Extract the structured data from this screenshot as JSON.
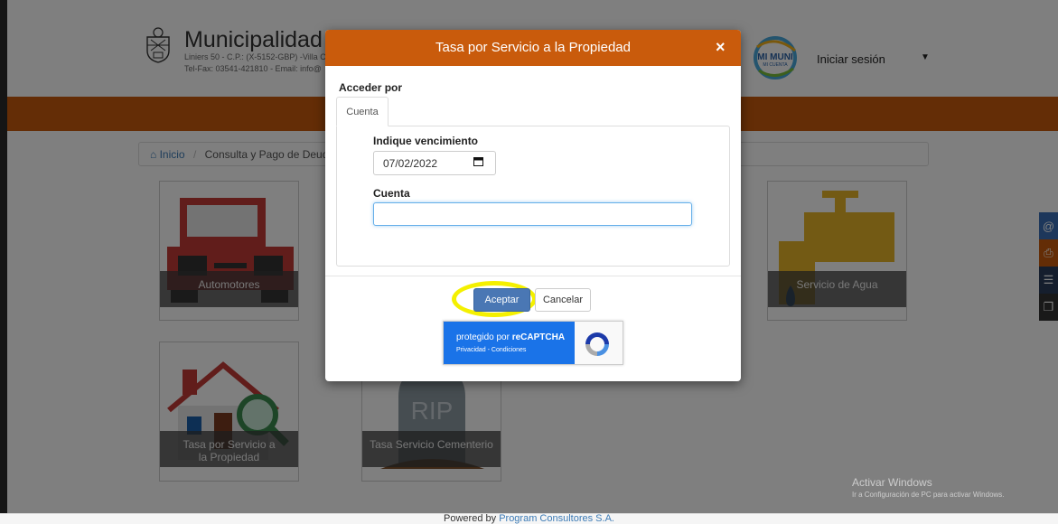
{
  "header": {
    "title": "Municipalidad d",
    "address": "Liniers 50 - C.P.: (X-5152-GBP) -Villa C",
    "contact": "Tel-Fax: 03541-421810 - Email: info@",
    "mimuni_line1": "MI MUNI",
    "mimuni_line2": "MI CUENTA",
    "login_label": "Iniciar sesión"
  },
  "breadcrumb": {
    "home": "Inicio",
    "current": "Consulta y Pago de Deuda"
  },
  "tiles": {
    "automotores": "Automotores",
    "agua": "Servicio de Agua",
    "propiedad": "Tasa por Servicio a la Propiedad",
    "cementerio": "Tasa Servicio Cementerio",
    "rip_text": "RIP"
  },
  "modal": {
    "title": "Tasa por Servicio a la Propiedad",
    "close_glyph": "×",
    "access_label": "Acceder por",
    "tab_label": "Cuenta",
    "due_label": "Indique vencimiento",
    "due_value": "07/02/2022",
    "account_label": "Cuenta",
    "account_value": "",
    "accept_label": "Aceptar",
    "cancel_label": "Cancelar"
  },
  "recaptcha": {
    "text_prefix": "protegido por ",
    "text_brand": "reCAPTCHA",
    "links": "Privacidad - Condiciones"
  },
  "footer": {
    "powered_prefix": "Powered by ",
    "powered_link": "Program Consultores S.A."
  },
  "watermark": {
    "line1": "Activar Windows",
    "line2": "Ir a Configuración de PC para activar Windows."
  },
  "colors": {
    "brand_orange": "#c95b0c",
    "primary_blue": "#4a77b4",
    "highlight_yellow": "#f4f000",
    "recaptcha_blue": "#1a73e8"
  },
  "icons": [
    "at-icon",
    "print-icon",
    "list-icon",
    "copy-icon",
    "home-icon",
    "calendar-icon",
    "close-icon",
    "recaptcha-logo-icon",
    "chevron-down-icon"
  ]
}
